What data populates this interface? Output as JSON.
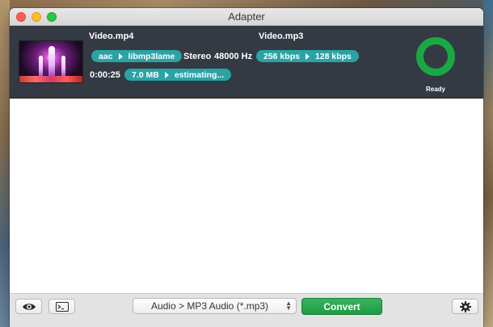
{
  "window": {
    "title": "Adapter"
  },
  "job": {
    "input_name": "Video.mp4",
    "output_name": "Video.mp3",
    "codec_from": "aac",
    "codec_to": "libmp3lame",
    "channels": "Stereo",
    "sample_rate": "48000 Hz",
    "bitrate_from": "256 kbps",
    "bitrate_to": "128 kbps",
    "duration": "0:00:25",
    "size_from": "7.0 MB",
    "size_to": "estimating...",
    "status": "Ready",
    "progress_color": "#1aa845"
  },
  "toolbar": {
    "preview_icon": "eye-icon",
    "log_icon": "terminal-icon",
    "format_selected": "Audio > MP3 Audio (*.mp3)",
    "convert_label": "Convert",
    "settings_icon": "gear-icon"
  }
}
